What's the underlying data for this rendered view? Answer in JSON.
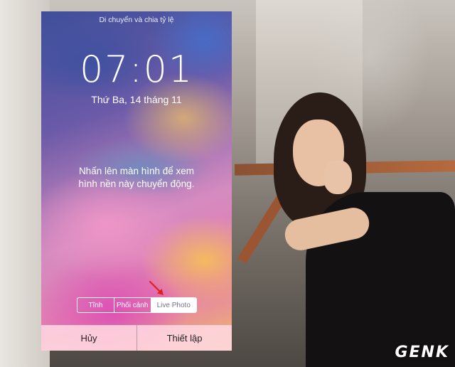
{
  "screen": {
    "title": "Di chuyển và chia tỷ lệ",
    "clock": "07:01",
    "date": "Thứ Ba, 14 tháng 11",
    "hint_line1": "Nhấn lên màn hình để xem",
    "hint_line2": "hình nền này chuyển động."
  },
  "segmented": {
    "options": [
      "Tĩnh",
      "Phối cảnh",
      "Live Photo"
    ],
    "selected": "Live Photo"
  },
  "actions": {
    "cancel_label": "Hủy",
    "set_label": "Thiết lập"
  },
  "watermark": "GENK",
  "annotation": {
    "arrow_color": "#e0201c",
    "arrow_icon": "red-arrow-icon"
  }
}
